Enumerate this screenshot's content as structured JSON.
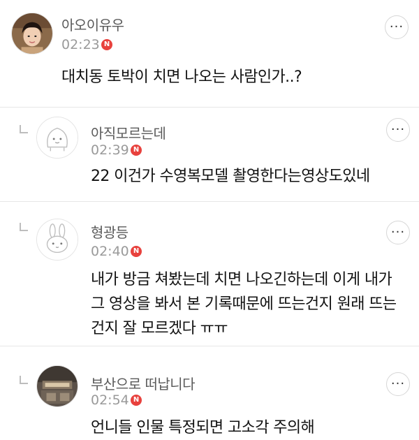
{
  "comments": [
    {
      "author": "아오이유우",
      "time": "02:23",
      "new_badge": "N",
      "lines": [
        "대치동 토박이 치면 나오는 사람인가..?"
      ],
      "more": "···"
    },
    {
      "author": "아직모르는데",
      "time": "02:39",
      "new_badge": "N",
      "lines": [
        "22 이건가 수영복모델 촬영한다는영상도있네"
      ],
      "more": "···"
    },
    {
      "author": "형광등",
      "time": "02:40",
      "new_badge": "N",
      "lines": [
        "내가 방금 쳐봤는데 치면 나오긴하는데 이게 내가",
        "그 영상을 봐서 본 기록때문에 뜨는건지 원래 뜨는",
        "건지 잘 모르겠다 ㅠㅠ"
      ],
      "more": "···"
    },
    {
      "author": "부산으로 떠납니다",
      "time": "02:54",
      "new_badge": "N",
      "lines": [
        "언니들 인물 특정되면 고소각 주의해"
      ],
      "more": "···"
    }
  ],
  "icons": {
    "reply": "reply-arrow-icon",
    "more": "more-options-icon",
    "new_badge_color": "#e8413d"
  }
}
